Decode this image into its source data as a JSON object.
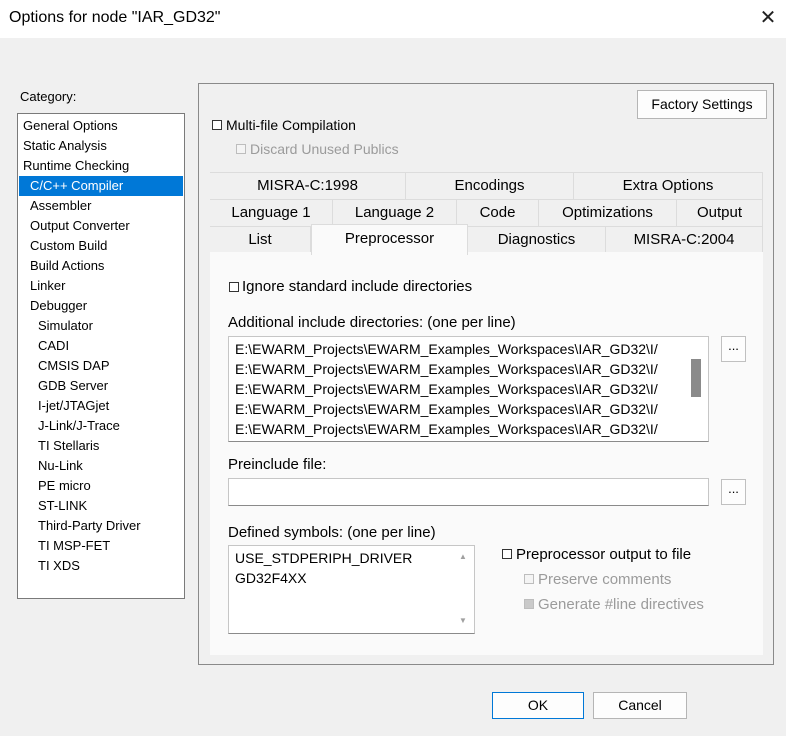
{
  "window": {
    "title": "Options for node \"IAR_GD32\"",
    "close_icon": "close-icon"
  },
  "category": {
    "label": "Category:",
    "items": [
      {
        "label": "General Options",
        "indent": 0
      },
      {
        "label": "Static Analysis",
        "indent": 0
      },
      {
        "label": "Runtime Checking",
        "indent": 0
      },
      {
        "label": "C/C++ Compiler",
        "indent": 1,
        "selected": true
      },
      {
        "label": "Assembler",
        "indent": 1
      },
      {
        "label": "Output Converter",
        "indent": 1
      },
      {
        "label": "Custom Build",
        "indent": 1
      },
      {
        "label": "Build Actions",
        "indent": 1
      },
      {
        "label": "Linker",
        "indent": 1
      },
      {
        "label": "Debugger",
        "indent": 1
      },
      {
        "label": "Simulator",
        "indent": 2
      },
      {
        "label": "CADI",
        "indent": 2
      },
      {
        "label": "CMSIS DAP",
        "indent": 2
      },
      {
        "label": "GDB Server",
        "indent": 2
      },
      {
        "label": "I-jet/JTAGjet",
        "indent": 2
      },
      {
        "label": "J-Link/J-Trace",
        "indent": 2
      },
      {
        "label": "TI Stellaris",
        "indent": 2
      },
      {
        "label": "Nu-Link",
        "indent": 2
      },
      {
        "label": "PE micro",
        "indent": 2
      },
      {
        "label": "ST-LINK",
        "indent": 2
      },
      {
        "label": "Third-Party Driver",
        "indent": 2
      },
      {
        "label": "TI MSP-FET",
        "indent": 2
      },
      {
        "label": "TI XDS",
        "indent": 2
      }
    ]
  },
  "panel": {
    "factory_settings": "Factory Settings",
    "multi_file": "Multi-file Compilation",
    "discard_unused": "Discard Unused Publics",
    "tabs_row1": [
      "MISRA-C:1998",
      "Encodings",
      "Extra Options"
    ],
    "tabs_row2": [
      "Language 1",
      "Language 2",
      "Code",
      "Optimizations",
      "Output"
    ],
    "tabs_row3": [
      "List",
      "Preprocessor",
      "Diagnostics",
      "MISRA-C:2004"
    ],
    "active_tab": "Preprocessor"
  },
  "preprocessor": {
    "ignore_std": "Ignore standard include directories",
    "additional_label": "Additional include directories: (one per line)",
    "include_dirs": [
      "E:\\EWARM_Projects\\EWARM_Examples_Workspaces\\IAR_GD32\\I/",
      "E:\\EWARM_Projects\\EWARM_Examples_Workspaces\\IAR_GD32\\I/",
      "E:\\EWARM_Projects\\EWARM_Examples_Workspaces\\IAR_GD32\\I/",
      "E:\\EWARM_Projects\\EWARM_Examples_Workspaces\\IAR_GD32\\I/",
      "E:\\EWARM_Projects\\EWARM_Examples_Workspaces\\IAR_GD32\\I/"
    ],
    "browse_label": "...",
    "preinclude_label": "Preinclude file:",
    "preinclude_value": "",
    "defined_label": "Defined symbols: (one per line)",
    "symbols": [
      "USE_STDPERIPH_DRIVER",
      "GD32F4XX"
    ],
    "pp_output": "Preprocessor output to file",
    "preserve_comments": "Preserve comments",
    "generate_line": "Generate #line directives"
  },
  "footer": {
    "ok": "OK",
    "cancel": "Cancel"
  }
}
